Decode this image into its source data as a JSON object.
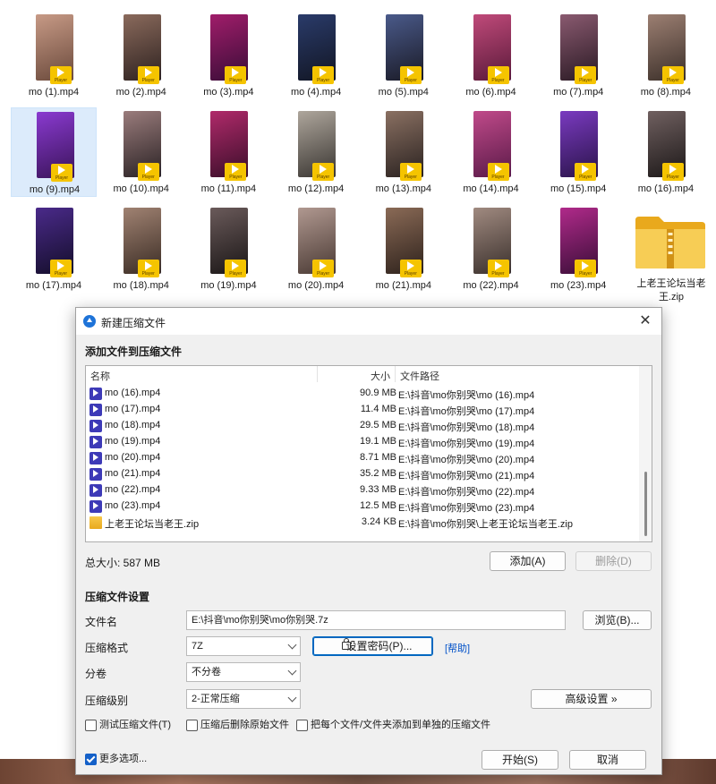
{
  "explorer": {
    "files": [
      {
        "name": "mo (1).mp4"
      },
      {
        "name": "mo (2).mp4"
      },
      {
        "name": "mo (3).mp4"
      },
      {
        "name": "mo (4).mp4"
      },
      {
        "name": "mo (5).mp4"
      },
      {
        "name": "mo (6).mp4"
      },
      {
        "name": "mo (7).mp4"
      },
      {
        "name": "mo (8).mp4"
      },
      {
        "name": "mo (9).mp4",
        "selected": true
      },
      {
        "name": "mo (10).mp4"
      },
      {
        "name": "mo (11).mp4"
      },
      {
        "name": "mo (12).mp4"
      },
      {
        "name": "mo (13).mp4"
      },
      {
        "name": "mo (14).mp4"
      },
      {
        "name": "mo (15).mp4"
      },
      {
        "name": "mo (16).mp4"
      },
      {
        "name": "mo (17).mp4"
      },
      {
        "name": "mo (18).mp4"
      },
      {
        "name": "mo (19).mp4"
      },
      {
        "name": "mo (20).mp4"
      },
      {
        "name": "mo (21).mp4"
      },
      {
        "name": "mo (22).mp4"
      },
      {
        "name": "mo (23).mp4"
      }
    ],
    "zip_file": {
      "name_line1": "上老王论坛当老",
      "name_line2": "王.zip"
    },
    "player_badge_text": "Player"
  },
  "dialog": {
    "title": "新建压缩文件",
    "add_section_title": "添加文件到压缩文件",
    "columns": {
      "name": "名称",
      "size": "大小",
      "path": "文件路径"
    },
    "rows": [
      {
        "name": "mo (16).mp4",
        "size": "90.9 MB",
        "path": "E:\\抖音\\mo你别哭\\mo (16).mp4",
        "type": "mp4"
      },
      {
        "name": "mo (17).mp4",
        "size": "11.4 MB",
        "path": "E:\\抖音\\mo你别哭\\mo (17).mp4",
        "type": "mp4"
      },
      {
        "name": "mo (18).mp4",
        "size": "29.5 MB",
        "path": "E:\\抖音\\mo你别哭\\mo (18).mp4",
        "type": "mp4"
      },
      {
        "name": "mo (19).mp4",
        "size": "19.1 MB",
        "path": "E:\\抖音\\mo你别哭\\mo (19).mp4",
        "type": "mp4"
      },
      {
        "name": "mo (20).mp4",
        "size": "8.71 MB",
        "path": "E:\\抖音\\mo你别哭\\mo (20).mp4",
        "type": "mp4"
      },
      {
        "name": "mo (21).mp4",
        "size": "35.2 MB",
        "path": "E:\\抖音\\mo你别哭\\mo (21).mp4",
        "type": "mp4"
      },
      {
        "name": "mo (22).mp4",
        "size": "9.33 MB",
        "path": "E:\\抖音\\mo你别哭\\mo (22).mp4",
        "type": "mp4"
      },
      {
        "name": "mo (23).mp4",
        "size": "12.5 MB",
        "path": "E:\\抖音\\mo你别哭\\mo (23).mp4",
        "type": "mp4"
      },
      {
        "name": "上老王论坛当老王.zip",
        "size": "3.24 KB",
        "path": "E:\\抖音\\mo你别哭\\上老王论坛当老王.zip",
        "type": "zip"
      }
    ],
    "total_size": "总大小: 587 MB",
    "add_button": "添加(A)",
    "delete_button": "删除(D)",
    "settings_title": "压缩文件设置",
    "filename_label": "文件名",
    "filename_value": "E:\\抖音\\mo你别哭\\mo你别哭.7z",
    "browse_button": "浏览(B)...",
    "format_label": "压缩格式",
    "format_value": "7Z",
    "password_button": "设置密码(P)...",
    "help_link": "[帮助]",
    "volume_label": "分卷",
    "volume_value": "不分卷",
    "level_label": "压缩级别",
    "level_value": "2-正常压缩",
    "advanced_button": "高级设置 »",
    "opt_test": "测试压缩文件(T)",
    "opt_delete": "压缩后删除原始文件",
    "opt_separate": "把每个文件/文件夹添加到单独的压缩文件",
    "more_options": "更多选项...",
    "start_button": "开始(S)",
    "cancel_button": "取消"
  },
  "colors": {
    "accent": "#0067c0",
    "player_badge": "#f5c400",
    "selected_tile": "#dcebfb"
  }
}
